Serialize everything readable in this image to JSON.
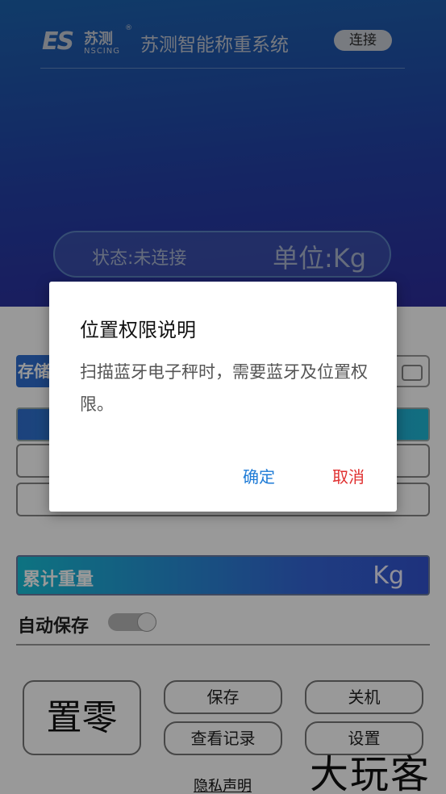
{
  "header": {
    "logo_letters": "ES",
    "logo_cn": "苏测",
    "logo_en": "NSCING",
    "logo_reg": "®",
    "title": "苏测智能称重系统",
    "connect_label": "连接"
  },
  "status": {
    "state_text": "状态:未连接",
    "unit_text": "单位:Kg"
  },
  "main": {
    "storage_label": "存储",
    "total_label": "累计重量",
    "total_unit": "Kg",
    "autosave_label": "自动保存",
    "autosave_on": false
  },
  "buttons": {
    "zero": "置零",
    "save": "保存",
    "shutdown": "关机",
    "records": "查看记录",
    "settings": "设置"
  },
  "privacy_link": "隐私声明",
  "watermark": "大玩客",
  "dialog": {
    "title": "位置权限说明",
    "message": "扫描蓝牙电子秤时，需要蓝牙及位置权限。",
    "ok": "确定",
    "cancel": "取消"
  },
  "colors": {
    "header_gradient_start": "#1c63ae",
    "header_gradient_end": "#2d2d9c",
    "ok_color": "#1e7bd6",
    "cancel_color": "#e03030"
  }
}
